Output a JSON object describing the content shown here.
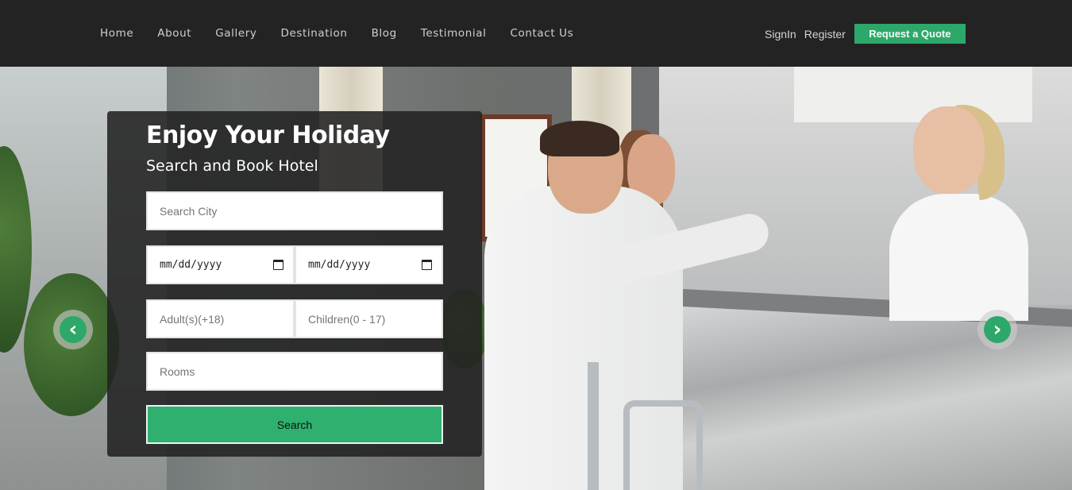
{
  "nav": {
    "items": [
      "Home",
      "About",
      "Gallery",
      "Destination",
      "Blog",
      "Testimonial",
      "Contact Us"
    ],
    "signin": "SignIn",
    "register": "Register",
    "quote_button": "Request a Quote"
  },
  "booking": {
    "title": "Enjoy Your Holiday",
    "subtitle": "Search and Book Hotel",
    "city_placeholder": "Search City",
    "checkin_value": "mm/dd/yyyy",
    "checkout_value": "mm/dd/yyyy",
    "adults_placeholder": "Adult(s)(+18)",
    "children_placeholder": "Children(0 - 17)",
    "rooms_placeholder": "Rooms",
    "search_button": "Search"
  },
  "carousel": {
    "prev_icon": "‹",
    "next_icon": "›"
  },
  "colors": {
    "accent": "#2ea86a",
    "nav_bg": "#232323"
  }
}
